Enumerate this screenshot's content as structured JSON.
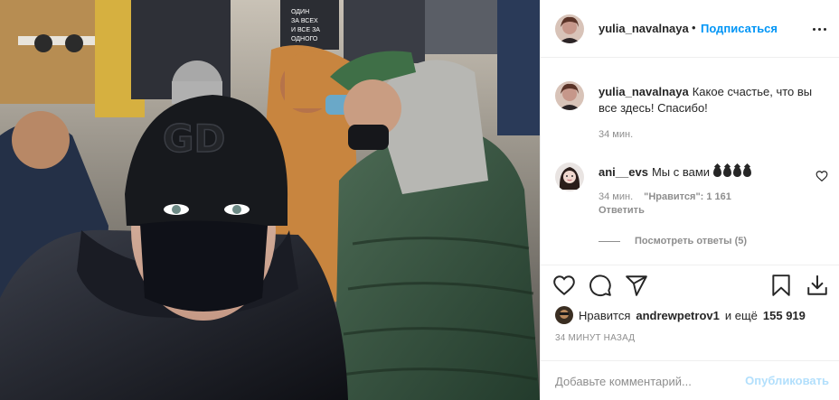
{
  "post": {
    "author": "yulia_navalnaya",
    "separator": "•",
    "follow_label": "Подписаться",
    "caption": "Какое счастье, что вы все здесь! Спасибо!",
    "caption_time": "34 мин.",
    "photo_sign_text": "ОДИН ЗА ВСЕХ И ВСЕ ЗА ОДНОГО",
    "beanie_logo": "GD"
  },
  "comment": {
    "author": "ani__evs",
    "text": "Мы с вами",
    "emoji_count": 4,
    "time": "34 мин.",
    "likes_label": "\"Нравится\": 1 161",
    "reply_label": "Ответить"
  },
  "replies": {
    "label": "Посмотреть ответы (5)"
  },
  "likes": {
    "prefix": "Нравится",
    "user": "andrewpetrov1",
    "conjunction": "и ещё",
    "count": "155 919"
  },
  "time_ago": "34 МИНУТ НАЗАД",
  "add_comment": {
    "placeholder": "Добавьте комментарий...",
    "publish_label": "Опубликовать"
  },
  "icons": {
    "like": "heart-icon",
    "comment": "comment-bubble-icon",
    "share": "paper-plane-icon",
    "save": "bookmark-icon",
    "download": "download-icon",
    "more": "more-dots-icon"
  },
  "colors": {
    "accent": "#0095f6",
    "publish_disabled": "#b2dffc",
    "muted": "#8e8e8e",
    "text": "#262626",
    "border": "#efefef"
  }
}
